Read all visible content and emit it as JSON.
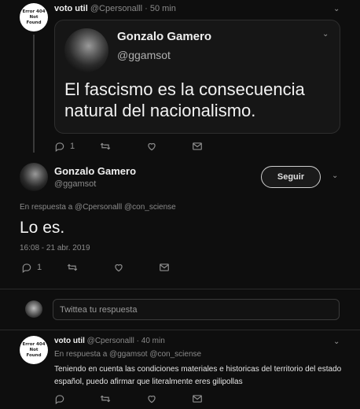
{
  "tweet1": {
    "author_avatar_lines": [
      "Error 404 Not",
      "Found"
    ],
    "author_name": "voto util",
    "author_handle": "@Cpersonalll",
    "separator": "·",
    "time": "50 min",
    "quote": {
      "name": "Gonzalo Gamero",
      "handle": "@ggamsot",
      "text": "El fascismo es la consecuencia natural del nacionalismo."
    },
    "actions": {
      "reply_count": "1",
      "retweet_count": "",
      "like_count": ""
    }
  },
  "main_tweet": {
    "name": "Gonzalo Gamero",
    "handle": "@ggamsot",
    "follow_label": "Seguir",
    "reply_to": "En respuesta a @Cpersonalll @con_sciense",
    "text": "Lo es.",
    "timestamp": "16:08 - 21 abr. 2019",
    "actions": {
      "reply_count": "1",
      "retweet_count": "",
      "like_count": ""
    }
  },
  "reply_box": {
    "placeholder": "Twittea tu respuesta"
  },
  "tweet3": {
    "author_avatar_lines": [
      "Error 404 Not",
      "Found"
    ],
    "author_name": "voto util",
    "author_handle": "@Cpersonalll",
    "separator": "·",
    "time": "40 min",
    "reply_to": "En respuesta a @ggamsot @con_sciense",
    "text": "Teniendo en cuenta las condiciones materiales e historicas del territorio del estado español, puedo afirmar que literalmente eres gilipollas",
    "actions": {
      "reply_count": "",
      "retweet_count": "",
      "like_count": ""
    }
  },
  "colors": {
    "background": "#0e0e0e",
    "card": "#161616",
    "text": "#e6e6e6",
    "muted": "#8a8a8a"
  }
}
